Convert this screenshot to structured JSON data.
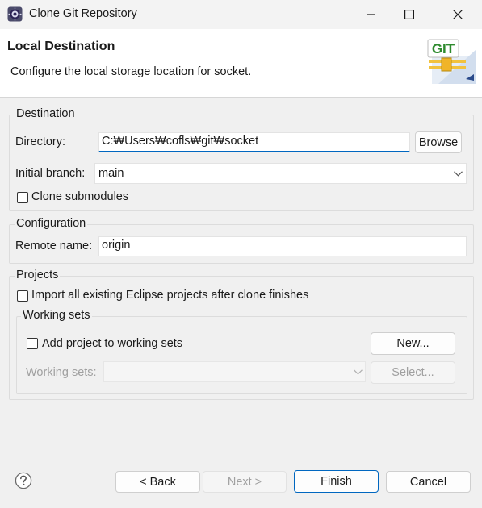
{
  "window": {
    "title": "Clone Git Repository",
    "icon": "eclipse-icon",
    "controls": [
      "minimize-icon",
      "maximize-icon",
      "close-icon"
    ]
  },
  "header": {
    "title": "Local Destination",
    "description": "Configure the local storage location for socket.",
    "logo_text": "GIT"
  },
  "destination": {
    "legend": "Destination",
    "directory_label": "Directory:",
    "directory_value": "C:₩Users₩cofls₩git₩socket",
    "browse_label": "Browse",
    "initial_branch_label": "Initial branch:",
    "initial_branch_value": "main",
    "clone_submodules_label": "Clone submodules",
    "clone_submodules_checked": false
  },
  "configuration": {
    "legend": "Configuration",
    "remote_name_label": "Remote name:",
    "remote_name_value": "origin"
  },
  "projects": {
    "legend": "Projects",
    "import_label": "Import all existing Eclipse projects after clone finishes",
    "import_checked": false,
    "working_sets": {
      "legend": "Working sets",
      "add_label": "Add project to working sets",
      "add_checked": false,
      "new_label": "New...",
      "sets_label": "Working sets:",
      "sets_value": "",
      "select_label": "Select..."
    }
  },
  "footer": {
    "help_icon": "help-icon",
    "back_label": "< Back",
    "next_label": "Next >",
    "finish_label": "Finish",
    "cancel_label": "Cancel"
  },
  "colors": {
    "accent": "#0067c0",
    "window_bg": "#f0f0f0",
    "banner_bg": "#ffffff",
    "disabled_text": "#a0a0a0"
  }
}
